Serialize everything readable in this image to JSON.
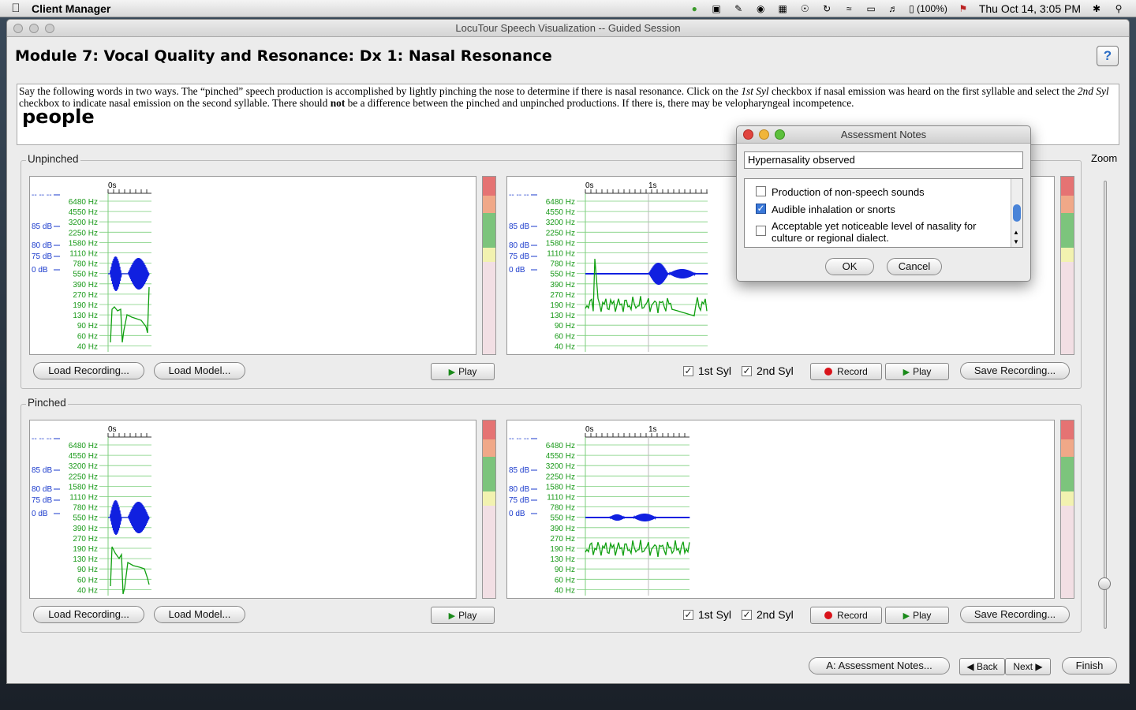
{
  "menubar": {
    "app_name": "Client Manager",
    "battery": "(100%)",
    "datetime": "Thu Oct 14,  3:05 PM",
    "icons": [
      "evernote-icon",
      "screen-icon",
      "wrench-icon",
      "globe-icon",
      "spaces-icon",
      "accessibility-icon",
      "time-machine-icon",
      "wifi-icon",
      "display-icon",
      "volume-icon",
      "battery-icon",
      "flag-icon",
      "bluetooth-icon",
      "spotlight-icon"
    ]
  },
  "window": {
    "title": "LocuTour Speech Visualization -- Guided Session",
    "heading": "Module 7: Vocal Quality and Resonance: Dx 1: Nasal Resonance",
    "help_label": "?"
  },
  "instructions": {
    "p1": "Say the following words in two ways. The “pinched” speech production is accomplished by lightly pinching the nose to determine if there is nasal resonance. Click on the ",
    "syl1": "1st Syl",
    "p2": " checkbox if nasal emission was heard on the first syllable and select the ",
    "syl2": "2nd Syl",
    "p3": " checkbox to indicate nasal emission on the second syllable. There should ",
    "not": "not",
    "p4": " be a difference between the pinched and unpinched productions. If there is, there may be velopharyngeal incompetence.",
    "word": "people"
  },
  "scale": {
    "db_labels": [
      "-- -- --",
      "85 dB",
      "80 dB",
      "75 dB",
      "0 dB"
    ],
    "hz_labels": [
      "6480 Hz",
      "4550 Hz",
      "3200 Hz",
      "2250 Hz",
      "1580 Hz",
      "1110 Hz",
      "780 Hz",
      "550 Hz",
      "390 Hz",
      "270 Hz",
      "190 Hz",
      "130 Hz",
      "90 Hz",
      "60 Hz",
      "40 Hz"
    ],
    "time_labels": [
      "0s",
      "1s"
    ]
  },
  "unpinched": {
    "label": "Unpinched",
    "load_recording": "Load Recording...",
    "load_model": "Load Model...",
    "model_play": "Play",
    "syl1_label": "1st Syl",
    "syl1_checked": true,
    "syl2_label": "2nd Syl",
    "syl2_checked": true,
    "record": "Record",
    "play": "Play",
    "save_recording": "Save Recording..."
  },
  "pinched": {
    "label": "Pinched",
    "load_recording": "Load Recording...",
    "load_model": "Load Model...",
    "model_play": "Play",
    "syl1_label": "1st Syl",
    "syl1_checked": true,
    "syl2_label": "2nd Syl",
    "syl2_checked": true,
    "record": "Record",
    "play": "Play",
    "save_recording": "Save Recording..."
  },
  "zoom": {
    "label": "Zoom"
  },
  "footer": {
    "assessment_notes": "A: Assessment Notes...",
    "back": "Back",
    "next": "Next",
    "finish": "Finish"
  },
  "dialog": {
    "title": "Assessment Notes",
    "field_value": "Hypernasality observed",
    "items": [
      {
        "label": "Production of non-speech sounds",
        "checked": false
      },
      {
        "label": "Audible inhalation or snorts",
        "checked": true
      },
      {
        "label": "Acceptable yet noticeable level of nasality for culture or regional dialect.",
        "checked": false
      }
    ],
    "ok": "OK",
    "cancel": "Cancel"
  },
  "colors": {
    "meter": [
      "#e57373",
      "#f0a888",
      "#7cc47c",
      "#f2f2b0",
      "#f2dfe4"
    ],
    "waveform": "#1020e0",
    "pitch": "#10a010",
    "scale_text": "#1a9a1a"
  }
}
